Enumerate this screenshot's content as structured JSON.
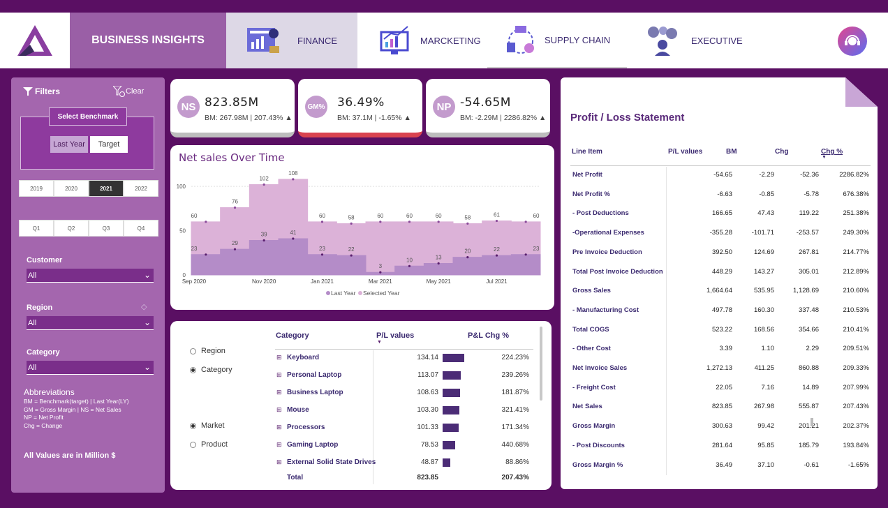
{
  "header": {
    "brand": "BUSINESS INSIGHTS",
    "tabs": [
      {
        "label": "FINANCE",
        "icon": "finance-icon"
      },
      {
        "label": "MARCKETING",
        "icon": "marketing-icon"
      },
      {
        "label": "SUPPLY CHAIN",
        "icon": "supply-chain-icon"
      },
      {
        "label": "EXECUTIVE",
        "icon": "executive-icon"
      }
    ]
  },
  "sidebar": {
    "filters_label": "Filters",
    "clear_label": "Clear",
    "benchmark_title": "Select Benchmark",
    "benchmark_options": [
      "Last Year",
      "Target"
    ],
    "years": [
      "2019",
      "2020",
      "2021",
      "2022"
    ],
    "selected_year": "2021",
    "quarters": [
      "Q1",
      "Q2",
      "Q3",
      "Q4"
    ],
    "customer": {
      "label": "Customer",
      "value": "All"
    },
    "region": {
      "label": "Region",
      "value": "All"
    },
    "category": {
      "label": "Category",
      "value": "All"
    },
    "abbrev_title": "Abbreviations",
    "abbrev_lines": [
      "BM = Benchmark(target) | Last Year(LY)",
      "GM = Gross Margin | NS = Net Sales",
      "NP = Net Profit",
      "Chg = Change"
    ],
    "note": "All Values are in Million $"
  },
  "kpis": [
    {
      "badge": "NS",
      "value": "823.85M",
      "bm": "BM: 267.98M | 207.43% ▲",
      "bar_color": "#bdbdbd"
    },
    {
      "badge": "GM%",
      "value": "36.49%",
      "bm": "BM: 37.1M | -1.65% ▲",
      "bar_color": "#d9434f"
    },
    {
      "badge": "NP",
      "value": "-54.65M",
      "bm": "BM: -2.29M | 2286.82% ▲",
      "bar_color": "#bdbdbd"
    }
  ],
  "chart_data": {
    "type": "area",
    "title": "Net sales Over Time",
    "x": [
      "Sep 2020",
      "Oct 2020",
      "Nov 2020",
      "Dec 2020",
      "Jan 2021",
      "Feb 2021",
      "Mar 2021",
      "Apr 2021",
      "May 2021",
      "Jun 2021",
      "Jul 2021",
      "Aug 2021"
    ],
    "x_tick_labels": [
      "Sep 2020",
      "Nov 2020",
      "Jan 2021",
      "Mar 2021",
      "May 2021",
      "Jul 2021"
    ],
    "series": [
      {
        "name": "Last Year",
        "values": [
          23,
          29,
          39,
          41,
          23,
          22,
          3,
          10,
          13,
          20,
          22,
          23
        ],
        "color": "#b48cc8"
      },
      {
        "name": "Selected Year",
        "values": [
          60,
          76,
          102,
          108,
          60,
          58,
          60,
          60,
          60,
          58,
          61,
          60
        ],
        "color": "#dcb2d8"
      }
    ],
    "y_ticks": [
      0,
      50,
      100
    ],
    "ylim": [
      0,
      115
    ],
    "legend": "bottom-center"
  },
  "category_panel": {
    "radios_top": [
      {
        "label": "Region",
        "checked": false
      },
      {
        "label": "Category",
        "checked": true
      }
    ],
    "radios_bottom": [
      {
        "label": "Market",
        "checked": true
      },
      {
        "label": "Product",
        "checked": false
      }
    ],
    "headers": [
      "Category",
      "P/L values",
      "P&L Chg %"
    ],
    "rows": [
      {
        "name": "Keyboard",
        "value": "134.14",
        "chg": "224.23%",
        "bar": 134.14
      },
      {
        "name": "Personal Laptop",
        "value": "113.07",
        "chg": "239.26%",
        "bar": 113.07
      },
      {
        "name": "Business Laptop",
        "value": "108.63",
        "chg": "181.87%",
        "bar": 108.63
      },
      {
        "name": "Mouse",
        "value": "103.30",
        "chg": "321.41%",
        "bar": 103.3
      },
      {
        "name": "Processors",
        "value": "101.33",
        "chg": "171.34%",
        "bar": 101.33
      },
      {
        "name": "Gaming Laptop",
        "value": "78.53",
        "chg": "440.68%",
        "bar": 78.53
      },
      {
        "name": "External Solid State Drives",
        "value": "48.87",
        "chg": "88.86%",
        "bar": 48.87
      }
    ],
    "total": {
      "name": "Total",
      "value": "823.85",
      "chg": "207.43%"
    }
  },
  "pl": {
    "title": "Profit / Loss Statement",
    "headers": [
      "Line Item",
      "P/L values",
      "BM",
      "Chg",
      "Chg %"
    ],
    "rows": [
      [
        "Net Profit",
        "-54.65",
        "-2.29",
        "-52.36",
        "2286.82%"
      ],
      [
        "Net Profit %",
        "-6.63",
        "-0.85",
        "-5.78",
        "676.38%"
      ],
      [
        "- Post Deductions",
        "166.65",
        "47.43",
        "119.22",
        "251.38%"
      ],
      [
        "-Operational Expenses",
        "-355.28",
        "-101.71",
        "-253.57",
        "249.30%"
      ],
      [
        "Pre Invoice Deduction",
        "392.50",
        "124.69",
        "267.81",
        "214.77%"
      ],
      [
        "Total Post Invoice Deduction",
        "448.29",
        "143.27",
        "305.01",
        "212.89%"
      ],
      [
        "Gross Sales",
        "1,664.64",
        "535.95",
        "1,128.69",
        "210.60%"
      ],
      [
        " - Manufacturing Cost",
        "497.78",
        "160.30",
        "337.48",
        "210.53%"
      ],
      [
        "Total COGS",
        "523.22",
        "168.56",
        "354.66",
        "210.41%"
      ],
      [
        " - Other Cost",
        "3.39",
        "1.10",
        "2.29",
        "209.51%"
      ],
      [
        "Net Invoice Sales",
        "1,272.13",
        "411.25",
        "860.88",
        "209.33%"
      ],
      [
        " - Freight Cost",
        "22.05",
        "7.16",
        "14.89",
        "207.99%"
      ],
      [
        "Net Sales",
        "823.85",
        "267.98",
        "555.87",
        "207.43%"
      ],
      [
        "Gross Margin",
        "300.63",
        "99.42",
        "201.21",
        "202.37%"
      ],
      [
        " - Post Discounts",
        "281.64",
        "95.85",
        "185.79",
        "193.84%"
      ],
      [
        "Gross Margin %",
        "36.49",
        "37.10",
        "-0.61",
        "-1.65%"
      ]
    ]
  }
}
